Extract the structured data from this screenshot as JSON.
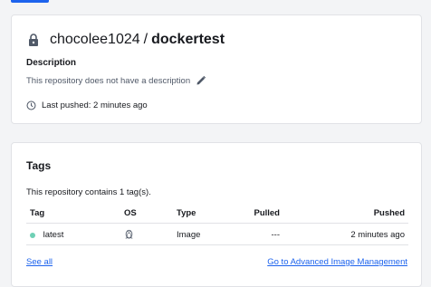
{
  "repo": {
    "namespace": "chocolee1024",
    "separator": "/",
    "name": "dockertest",
    "description_title": "Description",
    "description_text": "This repository does not have a description",
    "last_pushed": "Last pushed: 2 minutes ago"
  },
  "tags": {
    "title": "Tags",
    "count_text": "This repository contains 1 tag(s).",
    "columns": {
      "tag": "Tag",
      "os": "OS",
      "type": "Type",
      "pulled": "Pulled",
      "pushed": "Pushed"
    },
    "rows": [
      {
        "tag": "latest",
        "os_icon": "linux-tux-icon",
        "type": "Image",
        "pulled": "---",
        "pushed": "2 minutes ago"
      }
    ],
    "see_all": "See all",
    "advanced_link": "Go to Advanced Image Management"
  },
  "colors": {
    "accent": "#1d63ed",
    "tag_status_dot": "#6fd0b5"
  }
}
